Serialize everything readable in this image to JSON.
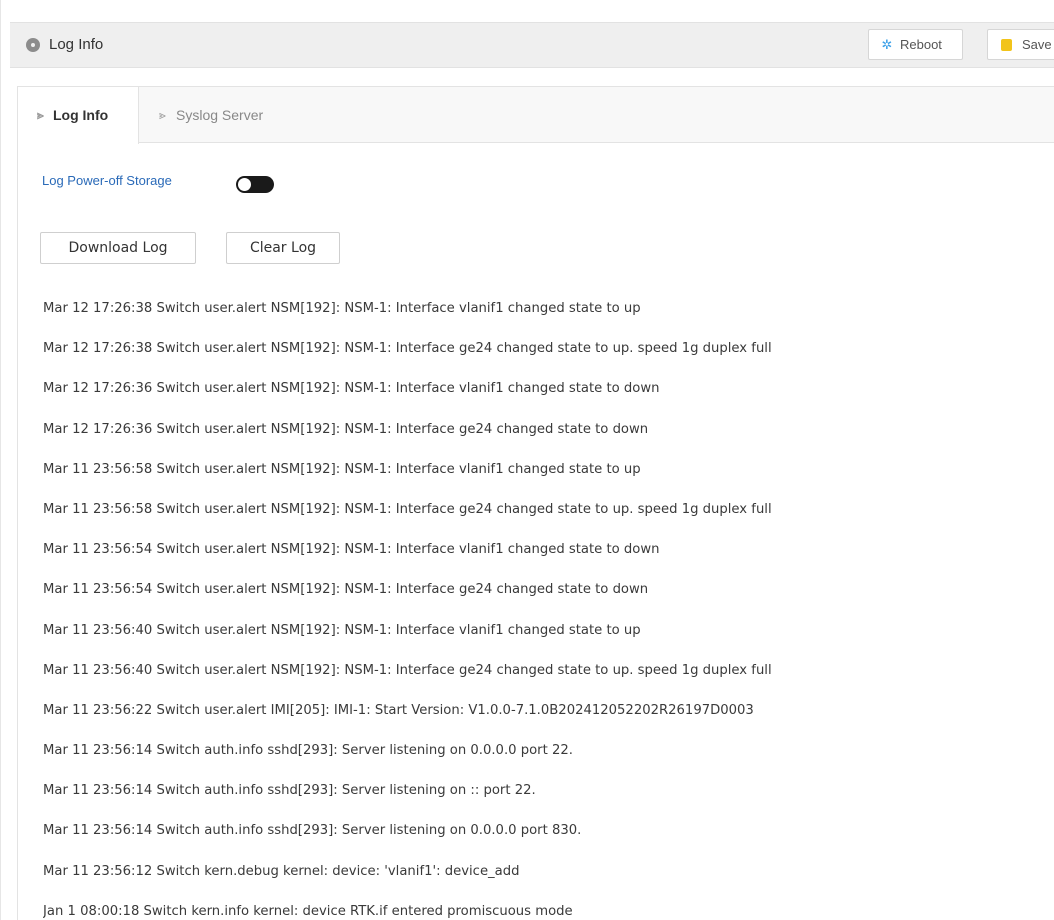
{
  "header": {
    "title": "Log Info",
    "icon": "info-circle-icon",
    "buttons": [
      {
        "label": "Reboot",
        "icon": "reboot-spinner-icon"
      },
      {
        "label": "Save",
        "icon": "save-icon"
      }
    ]
  },
  "tabs": [
    {
      "label": "Log Info",
      "active": true
    },
    {
      "label": "Syslog Server",
      "active": false
    }
  ],
  "storage": {
    "label": "Log Power-off Storage",
    "enabled": false
  },
  "actions": {
    "download_label": "Download Log",
    "clear_label": "Clear Log"
  },
  "logs": [
    "Mar 12 17:26:38 Switch user.alert NSM[192]: NSM-1: Interface vlanif1 changed state to up",
    "Mar 12 17:26:38 Switch user.alert NSM[192]: NSM-1: Interface ge24 changed state to up. speed 1g duplex full",
    "Mar 12 17:26:36 Switch user.alert NSM[192]: NSM-1: Interface vlanif1 changed state to down",
    "Mar 12 17:26:36 Switch user.alert NSM[192]: NSM-1: Interface ge24 changed state to down",
    "Mar 11 23:56:58 Switch user.alert NSM[192]: NSM-1: Interface vlanif1 changed state to up",
    "Mar 11 23:56:58 Switch user.alert NSM[192]: NSM-1: Interface ge24 changed state to up. speed 1g duplex full",
    "Mar 11 23:56:54 Switch user.alert NSM[192]: NSM-1: Interface vlanif1 changed state to down",
    "Mar 11 23:56:54 Switch user.alert NSM[192]: NSM-1: Interface ge24 changed state to down",
    "Mar 11 23:56:40 Switch user.alert NSM[192]: NSM-1: Interface vlanif1 changed state to up",
    "Mar 11 23:56:40 Switch user.alert NSM[192]: NSM-1: Interface ge24 changed state to up. speed 1g duplex full",
    "Mar 11 23:56:22 Switch user.alert IMI[205]: IMI-1: Start Version: V1.0.0-7.1.0B202412052202R26197D0003",
    "Mar 11 23:56:14 Switch auth.info sshd[293]: Server listening on 0.0.0.0 port 22.",
    "Mar 11 23:56:14 Switch auth.info sshd[293]: Server listening on :: port 22.",
    "Mar 11 23:56:14 Switch auth.info sshd[293]: Server listening on 0.0.0.0 port 830.",
    "Mar 11 23:56:12 Switch kern.debug kernel: device: 'vlanif1': device_add",
    "Jan 1 08:00:18 Switch kern.info kernel: device RTK.if entered promiscuous mode"
  ]
}
